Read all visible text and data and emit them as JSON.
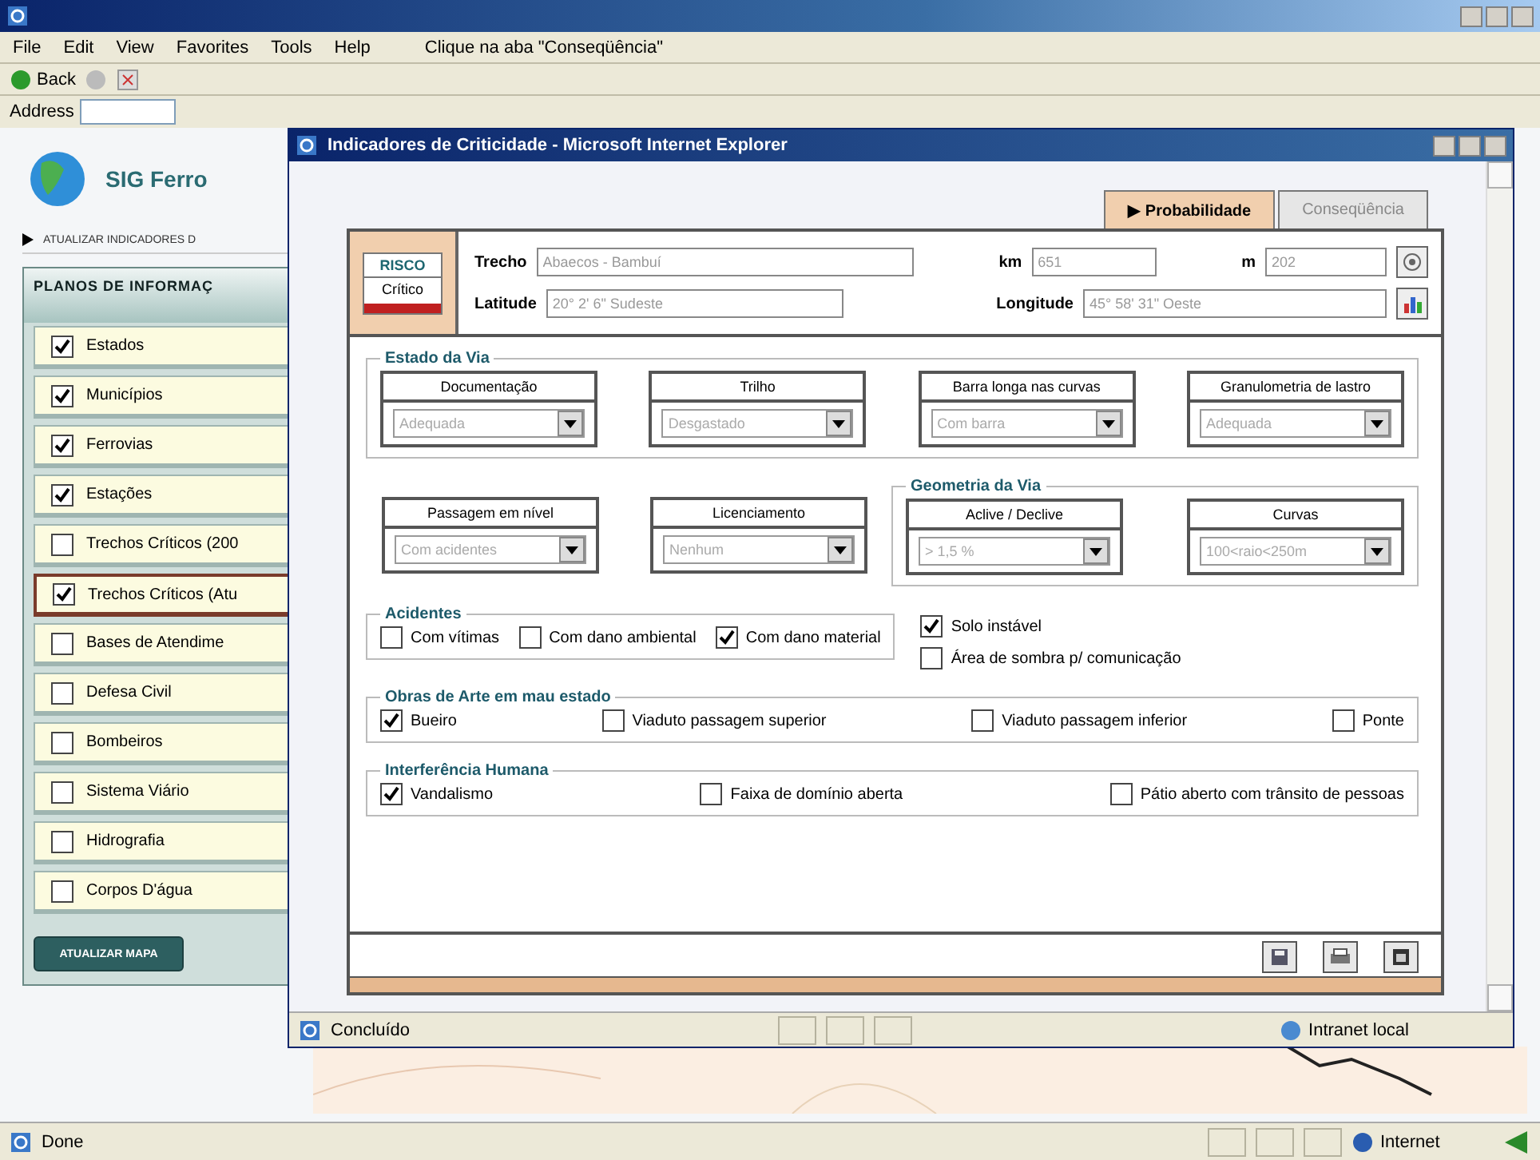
{
  "browser": {
    "menu": [
      "File",
      "Edit",
      "View",
      "Favorites",
      "Tools",
      "Help"
    ],
    "hint": "Clique na aba \"Conseqüência\"",
    "back": "Back",
    "address_label": "Address"
  },
  "sidebar": {
    "logo": "SIG Ferro",
    "link": "ATUALIZAR INDICADORES D",
    "panel_title": "PLANOS DE INFORMAÇ",
    "layers": [
      {
        "label": "Estados",
        "checked": true,
        "selected": false
      },
      {
        "label": "Municípios",
        "checked": true,
        "selected": false
      },
      {
        "label": "Ferrovias",
        "checked": true,
        "selected": false
      },
      {
        "label": "Estações",
        "checked": true,
        "selected": false
      },
      {
        "label": "Trechos Críticos (200",
        "checked": false,
        "selected": false
      },
      {
        "label": "Trechos Críticos (Atu",
        "checked": true,
        "selected": true
      },
      {
        "label": "Bases de Atendime",
        "checked": false,
        "selected": false
      },
      {
        "label": "Defesa Civil",
        "checked": false,
        "selected": false
      },
      {
        "label": "Bombeiros",
        "checked": false,
        "selected": false
      },
      {
        "label": "Sistema Viário",
        "checked": false,
        "selected": false
      },
      {
        "label": "Hidrografia",
        "checked": false,
        "selected": false
      },
      {
        "label": "Corpos D'água",
        "checked": false,
        "selected": false
      }
    ],
    "button": "ATUALIZAR MAPA"
  },
  "status_bar": {
    "text": "Done",
    "zone": "Internet"
  },
  "popup": {
    "title": "Indicadores de Criticidade - Microsoft Internet Explorer",
    "tabs": [
      {
        "label": "▶ Probabilidade",
        "selected": true
      },
      {
        "label": "Conseqüência",
        "selected": false
      }
    ],
    "risk": {
      "label": "RISCO",
      "value": "Crítico"
    },
    "trecho": {
      "label": "Trecho",
      "value": "Abaecos - Bambuí"
    },
    "km": {
      "label": "km",
      "value": "651"
    },
    "m": {
      "label": "m",
      "value": "202"
    },
    "latitude": {
      "label": "Latitude",
      "value": "20° 2' 6\" Sudeste"
    },
    "longitude": {
      "label": "Longitude",
      "value": "45° 58' 31\" Oeste"
    },
    "estado_da_via": {
      "title": "Estado da Via",
      "selects": [
        {
          "label": "Documentação",
          "value": "Adequada"
        },
        {
          "label": "Trilho",
          "value": "Desgastado"
        },
        {
          "label": "Barra longa nas curvas",
          "value": "Com barra"
        },
        {
          "label": "Granulometria de lastro",
          "value": "Adequada"
        }
      ]
    },
    "other_selects": [
      {
        "label": "Passagem em nível",
        "value": "Com acidentes"
      },
      {
        "label": "Licenciamento",
        "value": "Nenhum"
      }
    ],
    "geometria_da_via": {
      "title": "Geometria da Via",
      "selects": [
        {
          "label": "Aclive / Declive",
          "value": "> 1,5 %"
        },
        {
          "label": "Curvas",
          "value": "100<raio<250m"
        }
      ]
    },
    "acidentes": {
      "title": "Acidentes",
      "options": [
        {
          "label": "Com vítimas",
          "checked": false
        },
        {
          "label": "Com dano ambiental",
          "checked": false
        },
        {
          "label": "Com dano material",
          "checked": true
        }
      ]
    },
    "solo": [
      {
        "label": "Solo instável",
        "checked": true
      },
      {
        "label": "Área de sombra p/ comunicação",
        "checked": false
      }
    ],
    "obras_de_arte": {
      "title": "Obras de Arte em mau estado",
      "options": [
        {
          "label": "Bueiro",
          "checked": true
        },
        {
          "label": "Viaduto passagem superior",
          "checked": false
        },
        {
          "label": "Viaduto passagem inferior",
          "checked": false
        },
        {
          "label": "Ponte",
          "checked": false
        }
      ]
    },
    "interferencia": {
      "title": "Interferência Humana",
      "options": [
        {
          "label": "Vandalismo",
          "checked": true
        },
        {
          "label": "Faixa de domínio aberta",
          "checked": false
        },
        {
          "label": "Pátio aberto com trânsito de pessoas",
          "checked": false
        }
      ]
    },
    "status": {
      "text": "Concluído",
      "zone": "Intranet local"
    }
  }
}
